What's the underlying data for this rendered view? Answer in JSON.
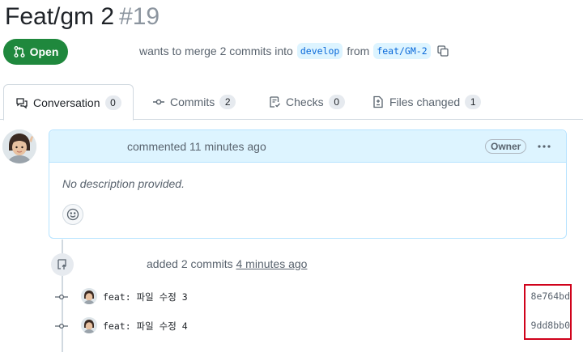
{
  "pr": {
    "title": "Feat/gm 2",
    "number": "#19",
    "state": "Open",
    "merge_text": "wants to merge 2 commits into",
    "base_branch": "develop",
    "from_text": "from",
    "head_branch": "feat/GM-2"
  },
  "tabs": [
    {
      "label": "Conversation",
      "count": "0",
      "icon": "comment-discussion-icon"
    },
    {
      "label": "Commits",
      "count": "2",
      "icon": "git-commit-icon"
    },
    {
      "label": "Checks",
      "count": "0",
      "icon": "checklist-icon"
    },
    {
      "label": "Files changed",
      "count": "1",
      "icon": "file-diff-icon"
    }
  ],
  "comment": {
    "header": "commented 11 minutes ago",
    "badge": "Owner",
    "body": "No description provided."
  },
  "event": {
    "text": "added 2 commits",
    "ago": "4 minutes ago"
  },
  "commits": [
    {
      "message": "feat: 파일 수정 3",
      "sha": "8e764bd"
    },
    {
      "message": "feat: 파일 수정 4",
      "sha": "9dd8bb0"
    }
  ],
  "colors": {
    "open_green": "#1f883d",
    "branch_blue": "#0969da",
    "highlight_red": "#d0021b",
    "comment_header_bg": "#ddf4ff"
  }
}
